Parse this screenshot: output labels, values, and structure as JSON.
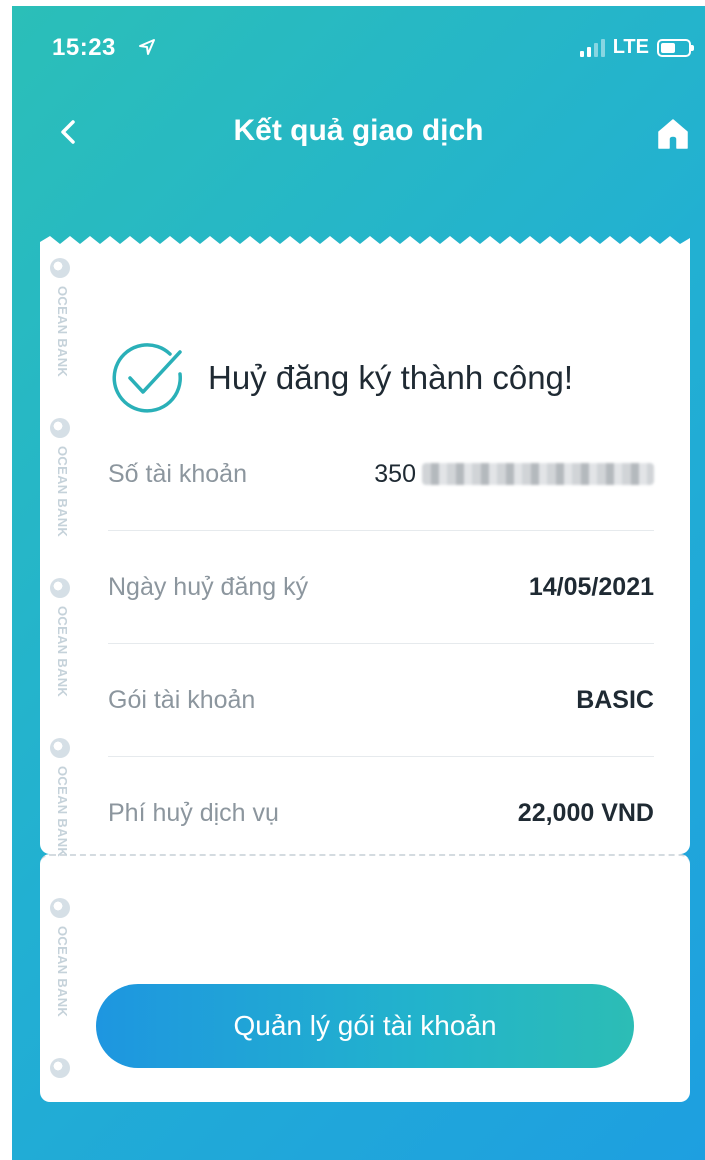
{
  "status_bar": {
    "time": "15:23",
    "network": "LTE",
    "icons": [
      "location-arrow-icon",
      "signal-icon",
      "battery-icon"
    ]
  },
  "header": {
    "title": "Kết quả giao dịch",
    "back_icon": "chevron-left-icon",
    "home_icon": "home-icon"
  },
  "result": {
    "message": "Huỷ đăng ký thành công!",
    "icon": "check-circle-icon"
  },
  "watermark": {
    "text": "OCEAN BANK"
  },
  "details": [
    {
      "label": "Số tài khoản",
      "value": "350",
      "masked": true
    },
    {
      "label": "Ngày huỷ đăng ký",
      "value": "14/05/2021"
    },
    {
      "label": "Gói tài khoản",
      "value": "BASIC"
    },
    {
      "label": "Phí huỷ dịch vụ",
      "value": "22,000 VND"
    }
  ],
  "action": {
    "manage_label": "Quản lý gói tài khoản"
  },
  "colors": {
    "gradient_start": "#2bbfb8",
    "gradient_end": "#1e9fe0",
    "success": "#2ab0b8",
    "text_dark": "#1f2a33",
    "text_muted": "#8c969e"
  }
}
